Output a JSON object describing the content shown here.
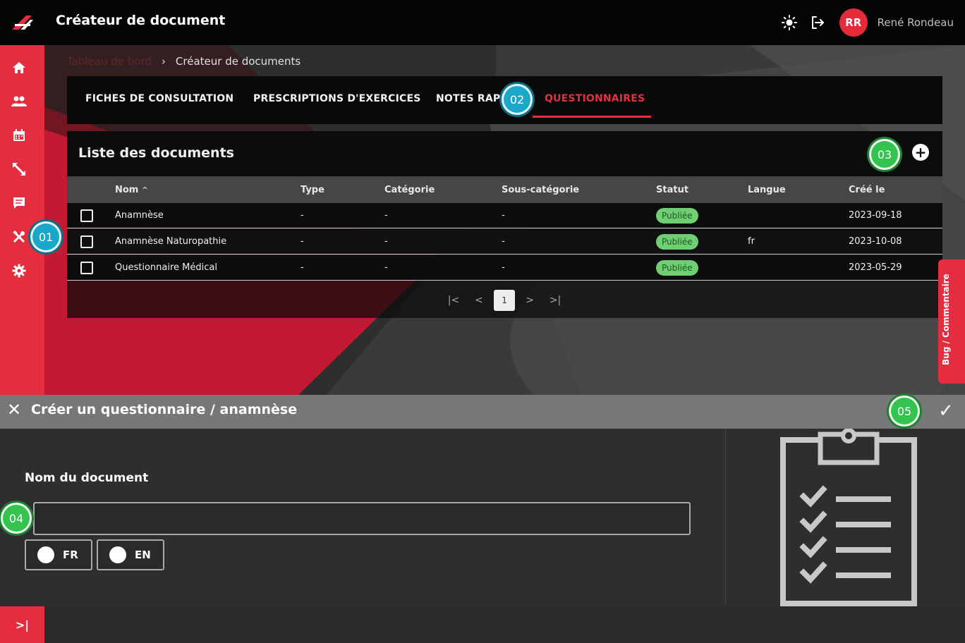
{
  "header": {
    "title": "Créateur de document",
    "user_initials": "RR",
    "user_name": "René Rondeau"
  },
  "sidebar": {
    "items": [
      "home-icon",
      "users-icon",
      "calendar-icon",
      "exercise-icon",
      "chat-icon",
      "tools-icon",
      "gear-icon"
    ]
  },
  "breadcrumb": {
    "parent": "Tableau de bord",
    "separator": "›",
    "current": "Créateur de documents"
  },
  "tabs": [
    {
      "label": "FICHES DE CONSULTATION"
    },
    {
      "label": "PRESCRIPTIONS D'EXERCICES"
    },
    {
      "label": "NOTES RAPI"
    },
    {
      "label": "QUESTIONNAIRES"
    }
  ],
  "card": {
    "title": "Liste des documents",
    "add_label": "+"
  },
  "table": {
    "columns": [
      "Nom",
      "Type",
      "Catégorie",
      "Sous-catégorie",
      "Statut",
      "Langue",
      "Créé le"
    ],
    "sort_indicator": "^",
    "rows": [
      {
        "name": "Anamnèse",
        "type": "-",
        "category": "-",
        "subcategory": "-",
        "status": "Publiée",
        "language": "",
        "created": "2023-09-18"
      },
      {
        "name": "Anamnèse Naturopathie",
        "type": "-",
        "category": "-",
        "subcategory": "-",
        "status": "Publiée",
        "language": "fr",
        "created": "2023-10-08"
      },
      {
        "name": "Questionnaire Médical",
        "type": "-",
        "category": "-",
        "subcategory": "-",
        "status": "Publiée",
        "language": "",
        "created": "2023-05-29"
      }
    ]
  },
  "pagination": {
    "first": "|<",
    "prev": "<",
    "current": "1",
    "next": ">",
    "last": ">|"
  },
  "bug_tab": {
    "label": "Bug / Commentaire"
  },
  "markers": [
    "01",
    "02",
    "03",
    "04",
    "05"
  ],
  "form": {
    "title": "Créer un questionnaire / anamnèse",
    "close": "✕",
    "confirm": "✓",
    "field_label": "Nom du document",
    "field_value": "",
    "lang_fr": "FR",
    "lang_en": "EN"
  },
  "footer": {
    "expand": ">|"
  },
  "colors": {
    "brand_red": "#e52d3f",
    "badge_green": "#6fcf73",
    "marker_blue": "#1aa7c9",
    "marker_green": "#34c34f"
  }
}
